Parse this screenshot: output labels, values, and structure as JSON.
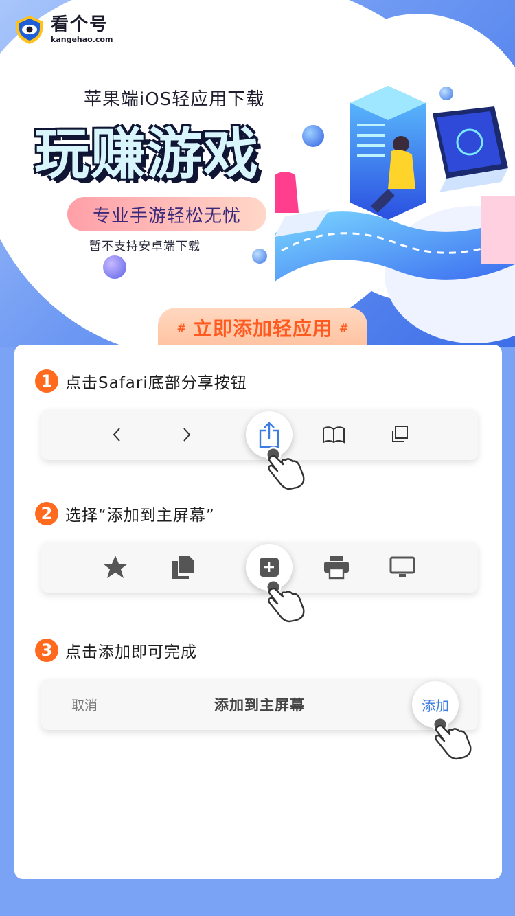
{
  "brand": {
    "name_cn": "看个号",
    "domain": "kangehao.com"
  },
  "hero": {
    "subtitle": "苹果端iOS轻应用下载",
    "title": "玩赚游戏",
    "pill": "专业手游轻松无忧",
    "note": "暂不支持安卓端下载",
    "cta": "立即添加轻应用",
    "cta_mark": "#"
  },
  "steps": [
    {
      "number": "1",
      "text": "点击Safari底部分享按钮"
    },
    {
      "number": "2",
      "text": "选择“添加到主屏幕”"
    },
    {
      "number": "3",
      "text": "点击添加即可完成"
    }
  ],
  "safari_bar_icons": [
    "back-icon",
    "forward-icon",
    "share-icon",
    "bookmarks-icon",
    "tabs-icon"
  ],
  "share_sheet_icons": [
    "star-icon",
    "copy-icon",
    "add-to-home-icon",
    "print-icon",
    "desktop-icon"
  ],
  "add_dialog": {
    "cancel": "取消",
    "title": "添加到主屏幕",
    "add": "添加"
  },
  "colors": {
    "accent": "#ff6a1f",
    "background": "#7aa3f6",
    "link": "#3b7de0"
  }
}
